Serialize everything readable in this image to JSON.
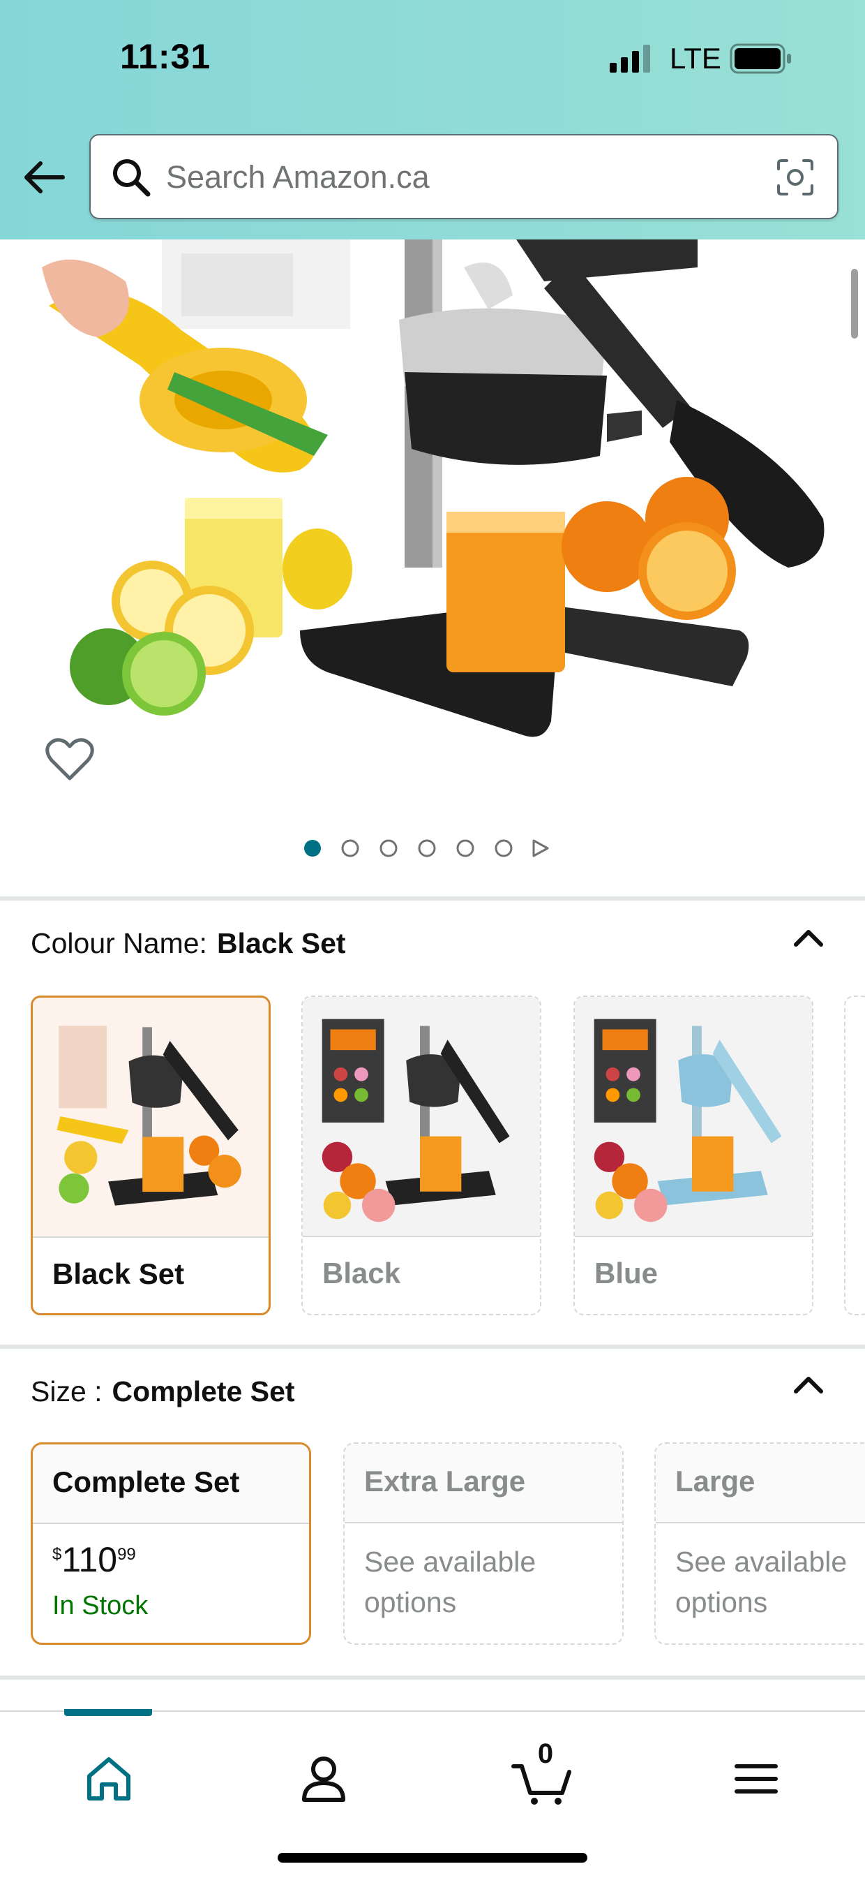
{
  "status_bar": {
    "time": "11:31",
    "network": "LTE"
  },
  "search": {
    "placeholder": "Search Amazon.ca"
  },
  "gallery": {
    "image_count": 6,
    "active_index": 0
  },
  "colour": {
    "label": "Colour Name:",
    "selected": "Black Set",
    "options": [
      {
        "name": "Black Set",
        "selected": true
      },
      {
        "name": "Black",
        "selected": false
      },
      {
        "name": "Blue",
        "selected": false
      }
    ]
  },
  "size": {
    "label": "Size :",
    "selected": "Complete Set",
    "options": [
      {
        "name": "Complete Set",
        "price_currency": "$",
        "price_whole": "110",
        "price_fraction": "99",
        "availability": "In Stock",
        "selected": true
      },
      {
        "name": "Extra Large",
        "note": "See available options",
        "selected": false
      },
      {
        "name": "Large",
        "note": "See available options",
        "selected": false
      }
    ]
  },
  "nav": {
    "cart_count": "0"
  },
  "colors": {
    "accent_teal": "#007185",
    "selected_border": "#d98a2b",
    "in_stock_green": "#007600"
  }
}
